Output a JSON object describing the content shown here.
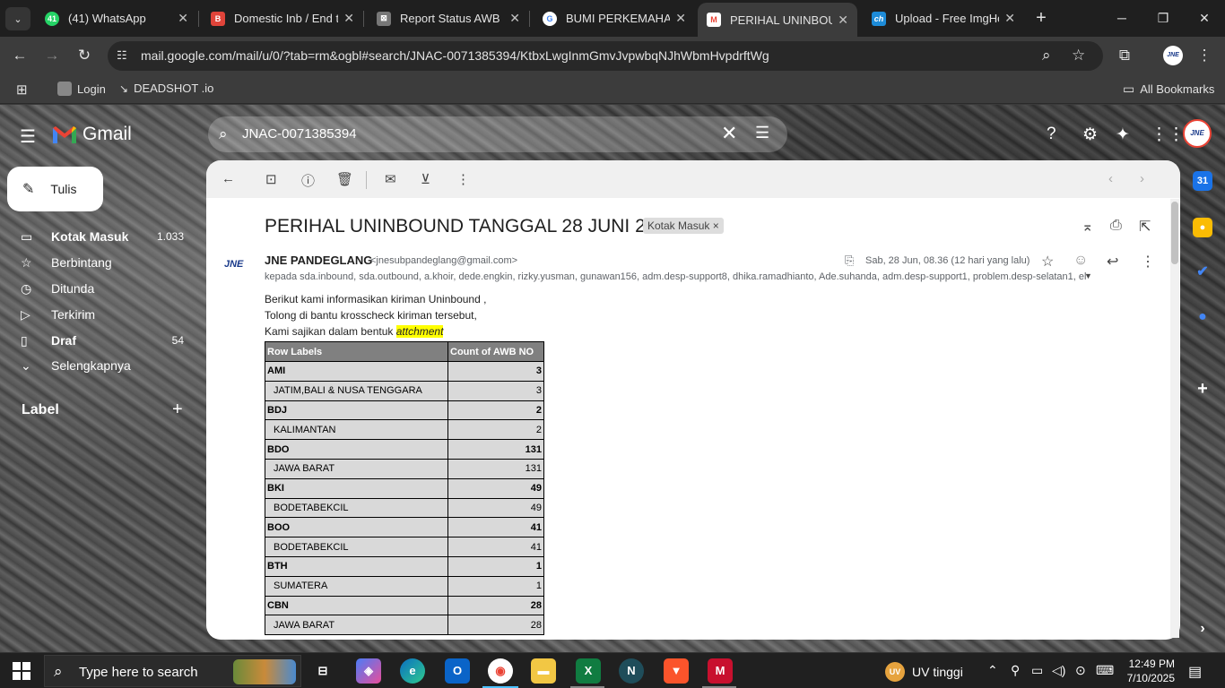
{
  "browser": {
    "tabs": [
      {
        "title": "(41) WhatsApp",
        "favicon": "whatsapp-icon",
        "favicon_text": "41",
        "color": "#25d366"
      },
      {
        "title": "Domestic Inb / End to",
        "favicon": "doc-icon",
        "favicon_text": "B",
        "color": "#e0443a"
      },
      {
        "title": "Report Status AWB",
        "favicon": "sheet-icon",
        "favicon_text": "⊠",
        "color": "#777777"
      },
      {
        "title": "BUMI PERKEMAHAN",
        "favicon": "google-icon",
        "favicon_text": "G",
        "color": "#4285f4"
      },
      {
        "title": "PERIHAL UNINBOUN",
        "favicon": "gmail-icon",
        "favicon_text": "M",
        "color": "#ea4335"
      },
      {
        "title": "Upload - Free ImgHo",
        "favicon": "imghost-icon",
        "favicon_text": "ch",
        "color": "#1d8bd8"
      }
    ],
    "url": "mail.google.com/mail/u/0/?tab=rm&ogbl#search/JNAC-0071385394/KtbxLwgInmGmvJvpwbqNJhWbmHvpdrftWg",
    "bookmarks": [
      "Login",
      "DEADSHOT .io",
      "All Bookmarks"
    ],
    "profile_text": "JNE"
  },
  "gmail": {
    "product": "Gmail",
    "search_value": "JNAC-0071385394",
    "compose_label": "Tulis",
    "nav": [
      {
        "label": "Kotak Masuk",
        "count": "1.033",
        "icon": "inbox-icon",
        "active": true
      },
      {
        "label": "Berbintang",
        "count": "",
        "icon": "star-icon"
      },
      {
        "label": "Ditunda",
        "count": "",
        "icon": "clock-icon"
      },
      {
        "label": "Terkirim",
        "count": "",
        "icon": "send-icon"
      },
      {
        "label": "Draf",
        "count": "54",
        "icon": "draft-icon"
      },
      {
        "label": "Selengkapnya",
        "count": "",
        "icon": "chevron-down-icon"
      }
    ],
    "labels_heading": "Label",
    "avatar_text": "JNE"
  },
  "email": {
    "subject": "PERIHAL UNINBOUND TANGGAL 28 JUNI 2025",
    "label_chip": "Kotak Masuk",
    "sender_name": "JNE PANDEGLANG",
    "sender_email": "<jnesubpandeglang@gmail.com>",
    "date": "Sab, 28 Jun, 08.36 (12 hari yang lalu)",
    "to": "kepada sda.inbound, sda.outbound, a.khoir, dede.engkin, rizky.yusman, gunawan156, adm.desp-support8, dhika.ramadhianto, Ade.suhanda, adm.desp-support1, problem.desp-selatan1, el",
    "body_lines": [
      "Berikut kami informasikan kiriman Uninbound ,",
      "Tolong di bantu krosscheck kiriman tersebut,",
      "Kami sajikan dalam bentuk "
    ],
    "highlight_word": "attchment",
    "table": {
      "headers": [
        "Row Labels",
        "Count of AWB NO"
      ],
      "rows": [
        {
          "label": "AMI",
          "count": "3",
          "group": true
        },
        {
          "label": "JATIM,BALI & NUSA TENGGARA",
          "count": "3",
          "group": false
        },
        {
          "label": "BDJ",
          "count": "2",
          "group": true
        },
        {
          "label": "KALIMANTAN",
          "count": "2",
          "group": false
        },
        {
          "label": "BDO",
          "count": "131",
          "group": true
        },
        {
          "label": "JAWA BARAT",
          "count": "131",
          "group": false
        },
        {
          "label": "BKI",
          "count": "49",
          "group": true
        },
        {
          "label": "BODETABEKCIL",
          "count": "49",
          "group": false
        },
        {
          "label": "BOO",
          "count": "41",
          "group": true
        },
        {
          "label": "BODETABEKCIL",
          "count": "41",
          "group": false
        },
        {
          "label": "BTH",
          "count": "1",
          "group": true
        },
        {
          "label": "SUMATERA",
          "count": "1",
          "group": false
        },
        {
          "label": "CBN",
          "count": "28",
          "group": true
        },
        {
          "label": "JAWA BARAT",
          "count": "28",
          "group": false
        }
      ]
    }
  },
  "taskbar": {
    "search_placeholder": "Type here to search",
    "weather": "UV tinggi",
    "weather_badge": "UV",
    "time": "12:49 PM",
    "date": "7/10/2025"
  }
}
